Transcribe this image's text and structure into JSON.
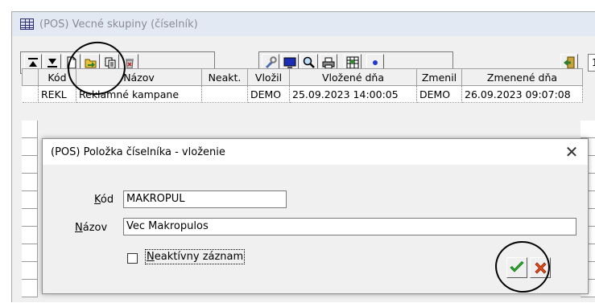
{
  "main_window": {
    "title": "(POS) Vecné skupiny (číselník)",
    "toolbar_number": "1"
  },
  "grid": {
    "columns": [
      "Kód",
      "Názov",
      "Neakt.",
      "Vložil",
      "Vložené dňa",
      "Zmenil",
      "Zmenené dňa"
    ],
    "rows": [
      [
        "REKL",
        "Reklamné kampane",
        "",
        "DEMO",
        "25.09.2023 14:00:05",
        "DEMO",
        "26.09.2023 09:07:08"
      ]
    ]
  },
  "dialog": {
    "title": "(POS) Položka číselníka - vloženie",
    "close_glyph": "✕",
    "code": {
      "label_underlined": "K",
      "label_rest": "ód",
      "value": "MAKROPUL"
    },
    "name": {
      "label_underlined": "N",
      "label_rest": "ázov",
      "value": "Vec Makropulos"
    },
    "inactive": {
      "label_underlined": "N",
      "label_rest": "eaktívny záznam",
      "checked": false
    }
  },
  "icons": {
    "toolbar": [
      "first-record-icon",
      "last-record-icon",
      "new-document-icon",
      "open-folder-icon",
      "copy-icon",
      "delete-bin-icon",
      "wrench-icon",
      "monitor-icon",
      "magnifier-icon",
      "printer-icon",
      "grid-export-icon",
      "blue-dot-icon",
      "exit-door-icon"
    ],
    "dialog": [
      "green-checkmark-icon",
      "red-cross-icon"
    ]
  },
  "colors": {
    "window_bg": "#f0f0f0",
    "title_bar_bg": "#e3e9f3",
    "ok_green": "#27b52b",
    "cancel_red": "#e24b1a"
  }
}
